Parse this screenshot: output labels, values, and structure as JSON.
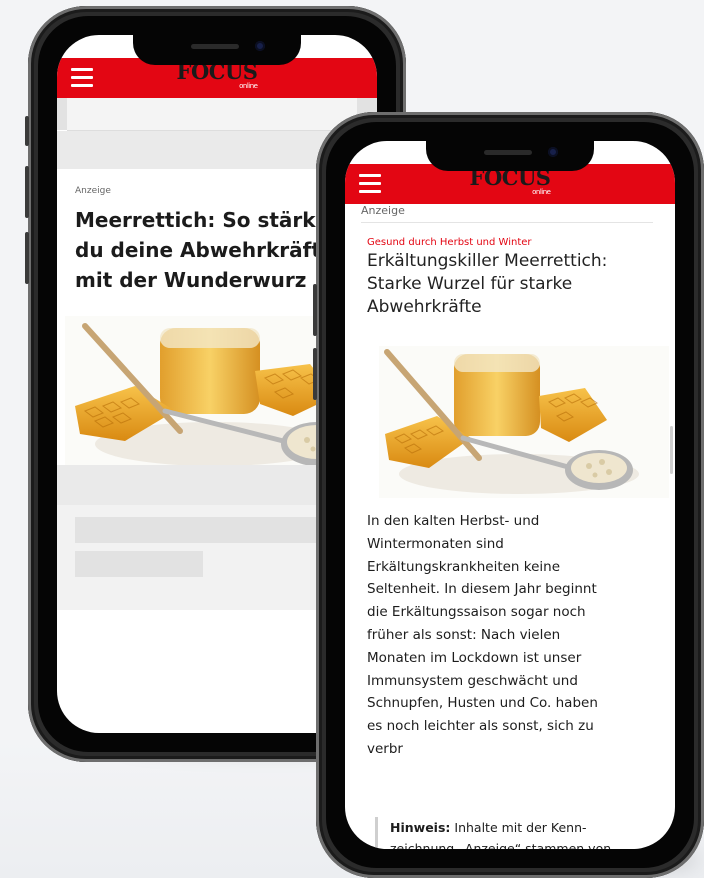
{
  "brand": {
    "logo": "FOCUS",
    "logo_sub": "online",
    "accent": "#e30613"
  },
  "back_phone": {
    "anzeige": "Anzeige",
    "headline_lines": [
      "Meerrettich: So stärk",
      "du deine Abwehrkräft",
      "mit der Wunderwurz"
    ],
    "image_icon": "honey-jar-horseradish-image"
  },
  "front_phone": {
    "anzeige": "Anzeige",
    "kicker": "Gesund durch Herbst und Winter",
    "headline_lines": [
      "Erkältungskiller Meerrettich:",
      "Starke Wurzel für starke",
      "Abwehrkräfte"
    ],
    "body_lines": [
      "In den kalten Herbst- und",
      "Wintermonaten sind",
      "Erkältungskrankheiten keine",
      "Seltenheit. In diesem Jahr beginnt",
      "die Erkältungssaison sogar noch",
      "früher als sonst: Nach vielen",
      "Monaten im Lockdown ist unser",
      "Immunsystem geschwächt und",
      "Schnupfen, Husten und Co. haben",
      "es noch leichter als sonst, sich zu",
      "verbr"
    ],
    "hint_label": "Hinweis:",
    "hint_lines": [
      "Inhalte mit der Kenn-",
      "zeichnung „Anzeige“ stammen von"
    ],
    "image_icon": "honey-jar-horseradish-image"
  }
}
